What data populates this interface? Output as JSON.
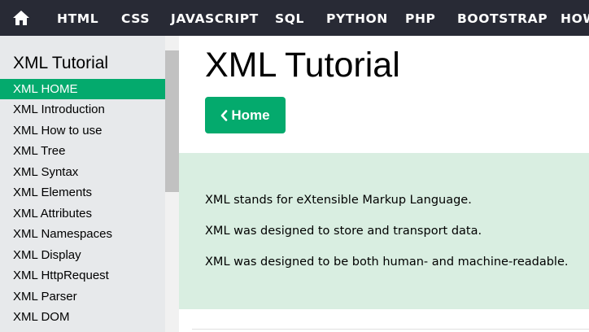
{
  "topnav": {
    "home_icon": "home-icon",
    "items": [
      "HTML",
      "CSS",
      "JAVASCRIPT",
      "SQL",
      "PYTHON",
      "PHP",
      "BOOTSTRAP",
      "HOW"
    ]
  },
  "sidebar": {
    "title": "XML Tutorial",
    "items": [
      "XML HOME",
      "XML Introduction",
      "XML How to use",
      "XML Tree",
      "XML Syntax",
      "XML Elements",
      "XML Attributes",
      "XML Namespaces",
      "XML Display",
      "XML HttpRequest",
      "XML Parser",
      "XML DOM"
    ],
    "active_item": "XML HOME"
  },
  "main": {
    "title": "XML Tutorial",
    "home_button_label": "Home",
    "home_button_icon": "chevron-left-icon",
    "intro": [
      "XML stands for eXtensible Markup Language.",
      "XML was designed to store and transport data.",
      "XML was designed to be both human- and machine-readable."
    ]
  },
  "colors": {
    "topnav_bg": "#282a35",
    "accent": "#04aa6d",
    "sidebar_bg": "#e7e9eb",
    "intro_bg": "#d9eee1"
  }
}
